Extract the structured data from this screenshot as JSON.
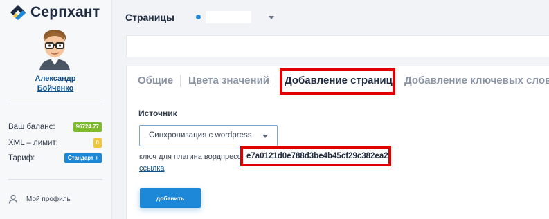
{
  "brand": {
    "name": "Серпхант"
  },
  "user": {
    "first_name": "Александр",
    "last_name": "Бойченко"
  },
  "stats": {
    "balance_label": "Ваш баланс:",
    "balance_value": "96724.77",
    "xml_label": "XML – лимит:",
    "xml_value": "0",
    "tariff_label": "Тариф:",
    "tariff_value": "Стандарт +"
  },
  "sidebar_nav": {
    "profile_label": "Мой профиль"
  },
  "header": {
    "title": "Страницы"
  },
  "tabs": [
    {
      "label": "Общие"
    },
    {
      "label": "Цвета значений"
    },
    {
      "label": "Добавление страниц"
    },
    {
      "label": "Добавление ключевых слов"
    }
  ],
  "form": {
    "source_label": "Источник",
    "source_value": "Синхронизация с wordpress",
    "key_label": "ключ для плагина вордпресс",
    "key_value": "e7a0121d0e788d3be4b45cf29c382ea2",
    "link_label": "ссылка",
    "add_button": "добавить"
  },
  "colors": {
    "accent": "#1e88d8",
    "highlight": "#e00000",
    "balance_badge": "#7dbb2c",
    "xml_badge": "#f2c63a"
  }
}
